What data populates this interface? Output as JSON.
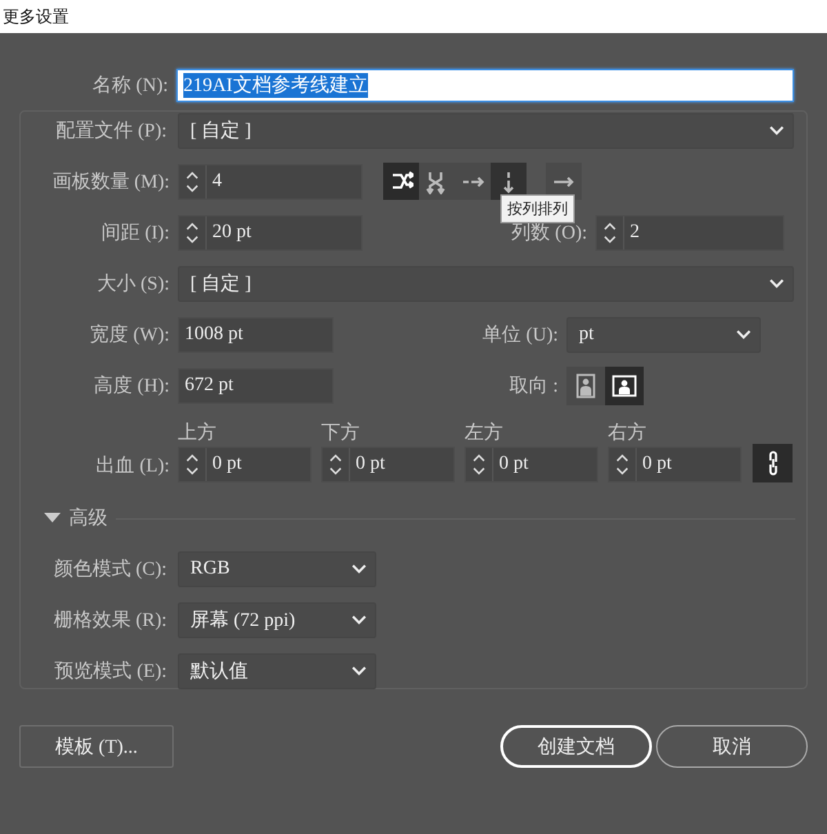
{
  "window": {
    "title": "更多设置"
  },
  "name": {
    "label": "名称 (N):",
    "value": "219AI文档参考线建立",
    "text_selected": true
  },
  "profile": {
    "label": "配置文件 (P):",
    "value": "[ 自定 ]"
  },
  "artboards": {
    "label": "画板数量 (M):",
    "value": "4",
    "layout_buttons": [
      {
        "kind": "grid-row",
        "selected": true,
        "hovered": false
      },
      {
        "kind": "grid-col",
        "selected": false,
        "hovered": false
      },
      {
        "kind": "row",
        "selected": false,
        "hovered": false
      },
      {
        "kind": "col",
        "selected": false,
        "hovered": true
      }
    ],
    "direction_button": {
      "kind": "right"
    }
  },
  "tooltip": {
    "text": "按列排列"
  },
  "spacing": {
    "label": "间距 (I):",
    "value": "20 pt"
  },
  "columns": {
    "label": "列数 (O):",
    "value": "2"
  },
  "size": {
    "label": "大小 (S):",
    "value": "[ 自定 ]"
  },
  "width": {
    "label": "宽度 (W):",
    "value": "1008 pt"
  },
  "unit": {
    "label": "单位 (U):",
    "value": "pt"
  },
  "height": {
    "label": "高度 (H):",
    "value": "672 pt"
  },
  "orientation": {
    "label": "取向 :",
    "options": [
      {
        "kind": "portrait",
        "selected": false
      },
      {
        "kind": "landscape",
        "selected": true
      }
    ]
  },
  "bleed": {
    "label": "出血 (L):",
    "linked": true,
    "sides": [
      {
        "label": "上方",
        "value": "0 pt"
      },
      {
        "label": "下方",
        "value": "0 pt"
      },
      {
        "label": "左方",
        "value": "0 pt"
      },
      {
        "label": "右方",
        "value": "0 pt"
      }
    ]
  },
  "advanced": {
    "label": "高级",
    "expanded": true
  },
  "color_mode": {
    "label": "颜色模式 (C):",
    "value": "RGB"
  },
  "raster": {
    "label": "栅格效果 (R):",
    "value": "屏幕 (72 ppi)"
  },
  "preview": {
    "label": "预览模式 (E):",
    "value": "默认值"
  },
  "buttons": [
    {
      "label": "模板 (T)...",
      "kind": "template",
      "focused": false
    },
    {
      "label": "创建文档",
      "kind": "primary",
      "focused": true
    },
    {
      "label": "取消",
      "kind": "cancel",
      "focused": false
    }
  ]
}
